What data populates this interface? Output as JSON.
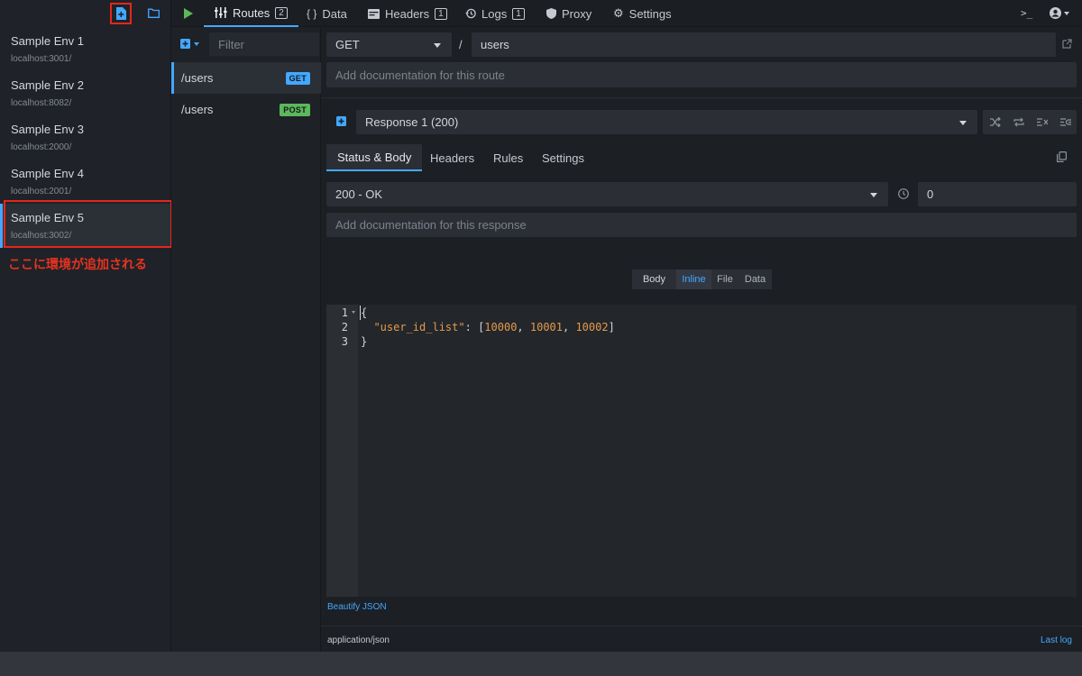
{
  "env_sidebar": {
    "envs": [
      {
        "name": "Sample Env 1",
        "host": "localhost:3001/"
      },
      {
        "name": "Sample Env 2",
        "host": "localhost:8082/"
      },
      {
        "name": "Sample Env 3",
        "host": "localhost:2000/"
      },
      {
        "name": "Sample Env 4",
        "host": "localhost:2001/"
      },
      {
        "name": "Sample Env 5",
        "host": "localhost:3002/"
      }
    ],
    "annotation": "ここに環境が追加される"
  },
  "topbar": {
    "tabs": [
      {
        "label": "Routes",
        "badge": "2"
      },
      {
        "label": "Data"
      },
      {
        "label": "Headers",
        "badge": "1"
      },
      {
        "label": "Logs",
        "badge": "1"
      },
      {
        "label": "Proxy"
      },
      {
        "label": "Settings"
      }
    ]
  },
  "routes": {
    "filter_placeholder": "Filter",
    "items": [
      {
        "path": "/users",
        "method": "GET",
        "color": "#43a8ff"
      },
      {
        "path": "/users",
        "method": "POST",
        "color": "#5cb85c"
      }
    ]
  },
  "route_editor": {
    "method": "GET",
    "separator": "/",
    "path": "users",
    "doc_placeholder": "Add documentation for this route",
    "response_select": "Response 1 (200)",
    "subtabs": [
      "Status & Body",
      "Headers",
      "Rules",
      "Settings"
    ],
    "status_select": "200 - OK",
    "latency": "0",
    "response_doc_placeholder": "Add documentation for this response",
    "body_label": "Body",
    "body_modes": [
      "Inline",
      "File",
      "Data"
    ],
    "code": {
      "line_numbers": [
        "1",
        "2",
        "3"
      ],
      "open_brace": "{",
      "key": "\"user_id_list\"",
      "colon": ": ",
      "open_bracket": "[",
      "values": [
        "10000",
        "10001",
        "10002"
      ],
      "comma": ", ",
      "close_bracket": "]",
      "close_brace": "}"
    },
    "beautify_link": "Beautify JSON",
    "content_type": "application/json",
    "last_log_link": "Last log"
  }
}
